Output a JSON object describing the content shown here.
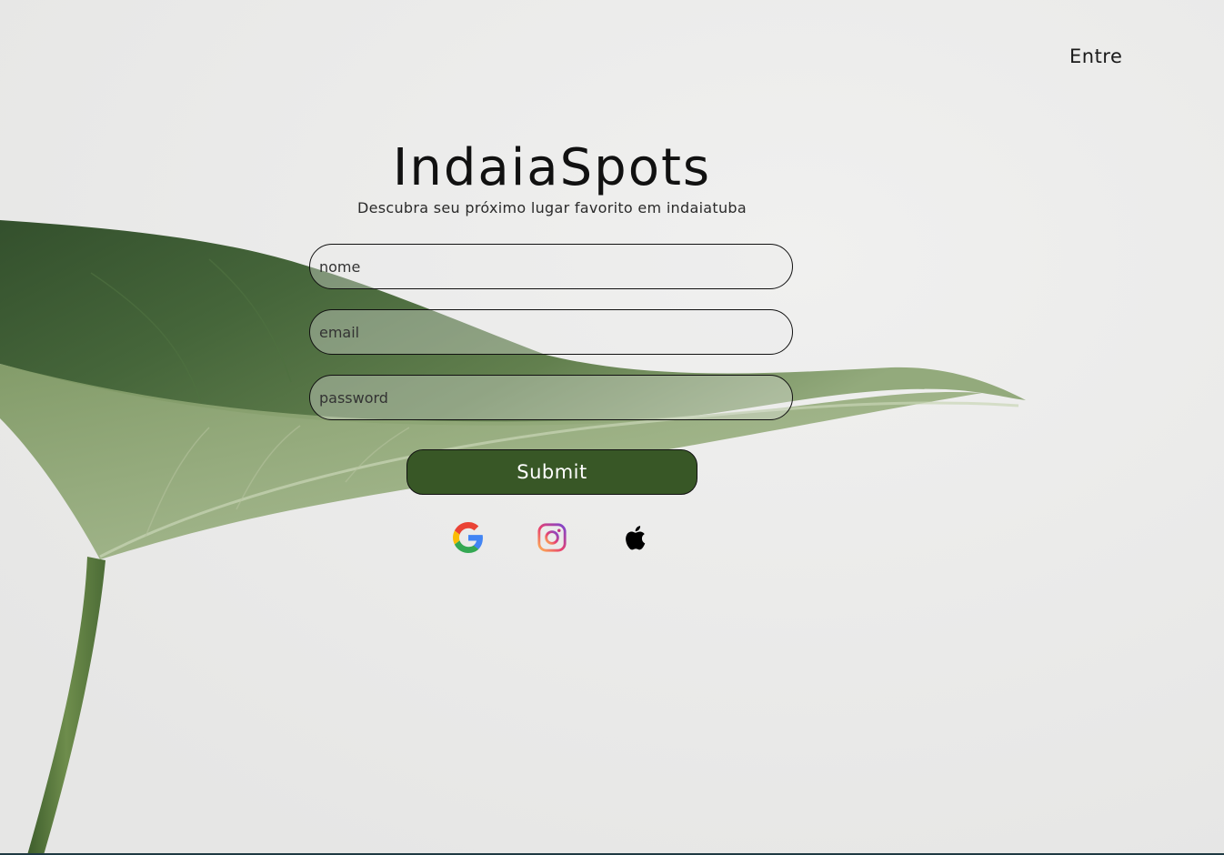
{
  "nav": {
    "login_link": "Entre"
  },
  "hero": {
    "title": "IndaiaSpots",
    "subtitle": "Descubra seu próximo lugar favorito em indaiatuba"
  },
  "form": {
    "name_placeholder": "nome",
    "email_placeholder": "email",
    "password_placeholder": "password",
    "submit_label": "Submit"
  },
  "social": {
    "icons": [
      "google-icon",
      "instagram-icon",
      "apple-icon"
    ]
  },
  "colors": {
    "background": "#ececeb",
    "submit_button": "#385726",
    "leaf_dark": "#2f4d27",
    "leaf_light": "#8fa673"
  }
}
